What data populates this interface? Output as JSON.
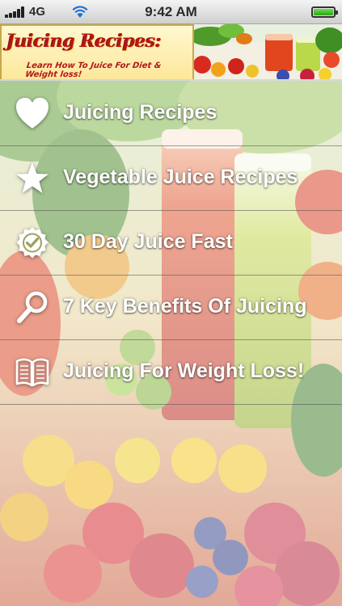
{
  "status_bar": {
    "carrier": "4G",
    "time": "9:42 AM",
    "signal_bars": 5,
    "battery_level": 1.0
  },
  "banner": {
    "title": "Juicing Recipes:",
    "subtitle": "Learn How To Juice For Diet & Weight loss!"
  },
  "menu": {
    "items": [
      {
        "label": "Juicing Recipes",
        "icon": "heart-icon"
      },
      {
        "label": "Vegetable Juice Recipes",
        "icon": "star-icon"
      },
      {
        "label": "30 Day Juice Fast",
        "icon": "badge-check-icon"
      },
      {
        "label": "7 Key Benefits Of Juicing",
        "icon": "magnifier-icon"
      },
      {
        "label": "Juicing For Weight Loss!",
        "icon": "open-book-icon"
      }
    ]
  },
  "colors": {
    "banner_title": "#b3161a",
    "menu_text": "#ffffff",
    "divider": "#505050"
  }
}
